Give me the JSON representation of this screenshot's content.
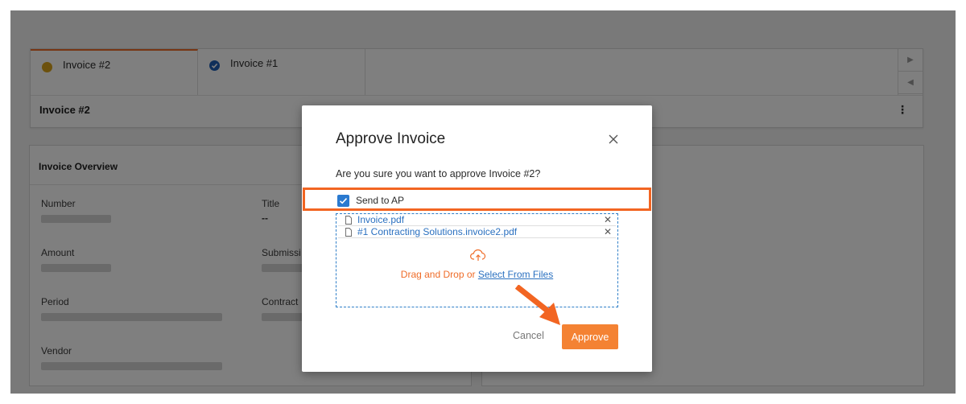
{
  "tabs": [
    {
      "label": "Invoice #2",
      "status_color": "#d9a21b",
      "active": true
    },
    {
      "label": "Invoice #1",
      "status_color": "#1f5fb5",
      "active": false
    }
  ],
  "tabs_title": "Invoice #2",
  "overview": {
    "header": "Invoice Overview",
    "fields": {
      "number": "Number",
      "title": "Title",
      "title_value": "--",
      "amount": "Amount",
      "submission": "Submissi",
      "period": "Period",
      "contract": "Contract",
      "vendor": "Vendor"
    }
  },
  "modal": {
    "title": "Approve Invoice",
    "question": "Are you sure you want to approve Invoice #2?",
    "checkbox_label": "Send to AP",
    "checkbox_checked": true,
    "files": [
      "Invoice.pdf",
      "#1 Contracting Solutions.invoice2.pdf"
    ],
    "drop_text": "Drag and Drop or",
    "select_link": "Select From Files",
    "cancel_label": "Cancel",
    "approve_label": "Approve"
  },
  "colors": {
    "accent": "#f48233",
    "highlight": "#f26522",
    "link": "#2a70c0",
    "checkbox": "#2a7ad0"
  },
  "icons": [
    "status-pending-icon",
    "status-check-icon",
    "chevron-right-icon",
    "chevron-left-icon",
    "kebab-menu-icon",
    "close-icon",
    "file-icon",
    "remove-icon",
    "cloud-upload-icon",
    "pointer-arrow-icon"
  ]
}
